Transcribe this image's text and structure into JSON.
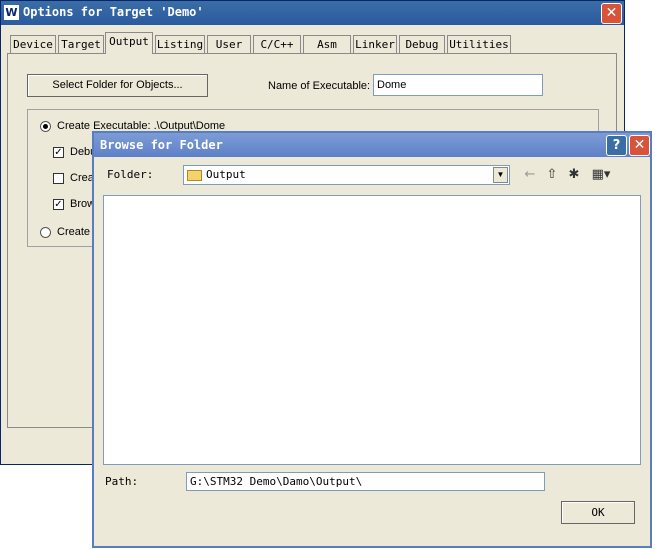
{
  "options": {
    "title": "Options for Target 'Demo'",
    "app_icon": "W",
    "tabs": [
      "Device",
      "Target",
      "Output",
      "Listing",
      "User",
      "C/C++",
      "Asm",
      "Linker",
      "Debug",
      "Utilities"
    ],
    "active_tab": "Output",
    "select_folder_label": "Select Folder for Objects...",
    "name_exec_label": "Name of Executable:",
    "name_exec_value": "Dome",
    "create_exec_label": "Create Executable:  .\\Output\\Dome",
    "debug_label": "Debu",
    "create_hex_label": "Crea",
    "browse_label": "Brow",
    "create_lib_label": "Create l"
  },
  "browse": {
    "title": "Browse for Folder",
    "folder_label": "Folder:",
    "folder_value": "Output",
    "path_label": "Path:",
    "path_value": "G:\\STM32 Demo\\Damo\\Output\\",
    "ok_label": "OK",
    "help_icon": "?",
    "close_icon": "✕"
  }
}
